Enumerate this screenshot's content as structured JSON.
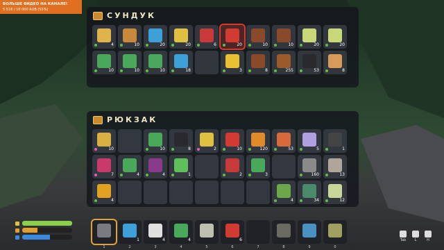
{
  "overlay": {
    "line1": "БОЛЬШЕ ВИДЕО НА КАНАЛЕ!",
    "line2": "5 516 / 10 000 RUB (55%)"
  },
  "chest": {
    "title": "СУНДУК",
    "slots": [
      {
        "color": "#e0b24a",
        "count": "4",
        "dot": "#5fbf4a"
      },
      {
        "color": "#c9893a",
        "count": "10",
        "dot": "#5fbf4a"
      },
      {
        "color": "#3ea0d8",
        "count": "20",
        "dot": "#5fbf4a"
      },
      {
        "color": "#e0c040",
        "count": "20",
        "dot": "#5fbf4a"
      },
      {
        "color": "#c83a3a",
        "count": "6",
        "dot": "#5fbf4a"
      },
      {
        "color": "#d33a32",
        "count": "20",
        "dot": "#5fbf4a",
        "selected": true
      },
      {
        "color": "#8a4a2a",
        "count": "10",
        "dot": "#5fbf4a"
      },
      {
        "color": "#8a4a2a",
        "count": "10",
        "dot": "#5fbf4a"
      },
      {
        "color": "#c8d878",
        "count": "20",
        "dot": "#5fbf4a"
      },
      {
        "color": "#c8d878",
        "count": "20",
        "dot": "#5fbf4a"
      },
      {
        "color": "#4aa85a",
        "count": "10",
        "dot": "#5fbf4a"
      },
      {
        "color": "#4aa85a",
        "count": "10",
        "dot": "#5fbf4a"
      },
      {
        "color": "#4aa85a",
        "count": "10",
        "dot": "#5fbf4a"
      },
      {
        "color": "#3ea0d8",
        "count": "18",
        "dot": "#5fbf4a"
      },
      {
        "color": "",
        "count": "",
        "dot": ""
      },
      {
        "color": "#e8c030",
        "count": "3",
        "dot": "#5fbf4a"
      },
      {
        "color": "#8a4a2a",
        "count": "8",
        "dot": "#5fbf4a"
      },
      {
        "color": "#9a5a2a",
        "count": "255",
        "dot": "#5fbf4a"
      },
      {
        "color": "#2a2a2e",
        "count": "53",
        "dot": "#5fbf4a"
      },
      {
        "color": "#d89a5a",
        "count": "8",
        "dot": "#5fbf4a"
      }
    ]
  },
  "backpack": {
    "title": "РЮКЗАК",
    "slots": [
      {
        "color": "#d8b040",
        "count": "10",
        "dot": "#e05fb0"
      },
      {
        "color": "",
        "count": "",
        "dot": ""
      },
      {
        "color": "#4aa85a",
        "count": "10",
        "dot": "#5fbf4a"
      },
      {
        "color": "#2a2a2e",
        "count": "8",
        "dot": "#5fbf4a"
      },
      {
        "color": "#e0c040",
        "count": "2",
        "dot": "#e05fb0"
      },
      {
        "color": "#d33a32",
        "count": "10",
        "dot": "#5fbf4a"
      },
      {
        "color": "#e08a2a",
        "count": "120",
        "dot": "#5fbf4a"
      },
      {
        "color": "#d86a3a",
        "count": "53",
        "dot": "#5fbf4a"
      },
      {
        "color": "#b0a0e0",
        "count": "5",
        "dot": "#5fbf4a"
      },
      {
        "color": "#444446",
        "count": "1",
        "dot": "#5fbf4a"
      },
      {
        "color": "#c83a6a",
        "count": "7",
        "dot": "#e05fb0"
      },
      {
        "color": "#4aa85a",
        "count": "4",
        "dot": "#5fbf4a"
      },
      {
        "color": "#8a3a8a",
        "count": "4",
        "dot": "#5fbf4a"
      },
      {
        "color": "#5fbf5a",
        "count": "1",
        "dot": "#5fbf4a"
      },
      {
        "color": "",
        "count": "",
        "dot": ""
      },
      {
        "color": "#c83a3a",
        "count": "2",
        "dot": "#5fbf4a"
      },
      {
        "color": "#4aa85a",
        "count": "3",
        "dot": "#5fbf4a"
      },
      {
        "color": "",
        "count": "",
        "dot": ""
      },
      {
        "color": "#8a8a8a",
        "count": "160",
        "dot": "#5fbf4a"
      },
      {
        "color": "#b0a59a",
        "count": "13",
        "dot": "#5fbf4a"
      },
      {
        "color": "#e0a020",
        "count": "4",
        "dot": "#5fbf4a"
      },
      {
        "color": "",
        "count": "",
        "dot": ""
      },
      {
        "color": "",
        "count": "",
        "dot": ""
      },
      {
        "color": "",
        "count": "",
        "dot": ""
      },
      {
        "color": "",
        "count": "",
        "dot": ""
      },
      {
        "color": "",
        "count": "",
        "dot": ""
      },
      {
        "color": "",
        "count": "",
        "dot": ""
      },
      {
        "color": "#6aa84a",
        "count": "4",
        "dot": "#5fbf4a"
      },
      {
        "color": "#4a8a6a",
        "count": "34",
        "dot": "#5fbf4a"
      },
      {
        "color": "#c8d898",
        "count": "12",
        "dot": "#5fbf4a"
      }
    ]
  },
  "hotbar": {
    "slots": [
      {
        "color": "#7a7a80",
        "count": "",
        "key": "1",
        "active": true
      },
      {
        "color": "#3ea0d8",
        "count": "1",
        "key": "2"
      },
      {
        "color": "#e0e0e0",
        "count": "4",
        "key": "3"
      },
      {
        "color": "#4aa85a",
        "count": "4",
        "key": "4"
      },
      {
        "color": "#c0c0b0",
        "count": "",
        "key": "5"
      },
      {
        "color": "#d33a32",
        "count": "6",
        "key": "6"
      },
      {
        "color": "",
        "count": "",
        "key": "7"
      },
      {
        "color": "#6a6a60",
        "count": "",
        "key": "8"
      },
      {
        "color": "#4a90c0",
        "count": "",
        "key": "9"
      },
      {
        "color": "#a0a060",
        "count": "",
        "key": "0"
      }
    ]
  },
  "status": {
    "health": {
      "color": "#8ad04a",
      "fill": 1.0
    },
    "stamina": {
      "color": "#e0a030",
      "fill": 0.3
    },
    "water": {
      "color": "#3a8ae0",
      "fill": 0.55
    }
  },
  "keys": [
    {
      "label": "Tab"
    },
    {
      "label": "L"
    },
    {
      "label": "H"
    }
  ]
}
